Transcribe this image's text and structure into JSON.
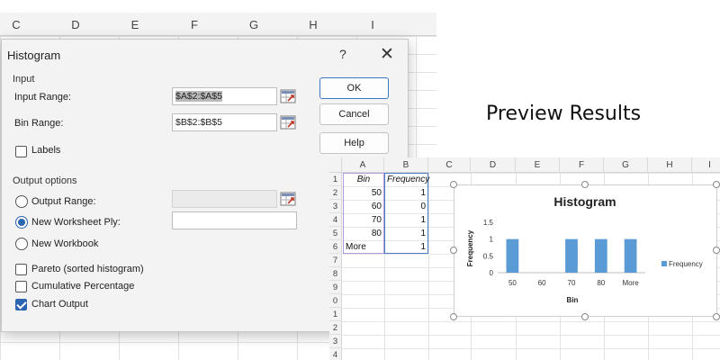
{
  "background_sheet": {
    "columns": [
      "C",
      "D",
      "E",
      "F",
      "G",
      "H",
      "I"
    ]
  },
  "dialog": {
    "title": "Histogram",
    "help_glyph": "?",
    "close_glyph": "✕",
    "input_section": "Input",
    "input_range_label": "Input Range:",
    "input_range_value": "$A$2:$A$5",
    "bin_range_label": "Bin Range:",
    "bin_range_value": "$B$2:$B$5",
    "labels_label": "Labels",
    "labels_checked": false,
    "output_section": "Output options",
    "output_range_label": "Output Range:",
    "new_worksheet_label": "New Worksheet Ply:",
    "new_workbook_label": "New Workbook",
    "selected_output": "new_worksheet",
    "pareto_label": "Pareto (sorted histogram)",
    "pareto_checked": false,
    "cumulative_label": "Cumulative Percentage",
    "cumulative_checked": false,
    "chart_output_label": "Chart Output",
    "chart_output_checked": true,
    "ok_label": "OK",
    "cancel_label": "Cancel",
    "help_label": "Help",
    "ref_icon": "range-selector-icon"
  },
  "preview_heading": "Preview Results",
  "result_sheet": {
    "columns": [
      "A",
      "B",
      "C",
      "D",
      "E",
      "F",
      "G",
      "H",
      "I"
    ],
    "rows": [
      "1",
      "2",
      "3",
      "4",
      "5",
      "6",
      "7",
      "8",
      "9",
      "0",
      "1",
      "2",
      "3",
      "4"
    ],
    "header": [
      "Bin",
      "Frequency"
    ],
    "table": [
      [
        "50",
        "1"
      ],
      [
        "60",
        "0"
      ],
      [
        "70",
        "1"
      ],
      [
        "80",
        "1"
      ],
      [
        "More",
        "1"
      ]
    ]
  },
  "chart_data": {
    "type": "bar",
    "title": "Histogram",
    "xlabel": "Bin",
    "ylabel": "Frequency",
    "categories": [
      "50",
      "60",
      "70",
      "80",
      "More"
    ],
    "series": [
      {
        "name": "Frequency",
        "values": [
          1,
          0,
          1,
          1,
          1
        ],
        "color": "#5b9bd5"
      }
    ],
    "ylim": [
      0,
      1.5
    ],
    "yticks": [
      "0",
      "0.5",
      "1",
      "1.5"
    ],
    "legend_position": "right",
    "grid": false
  }
}
